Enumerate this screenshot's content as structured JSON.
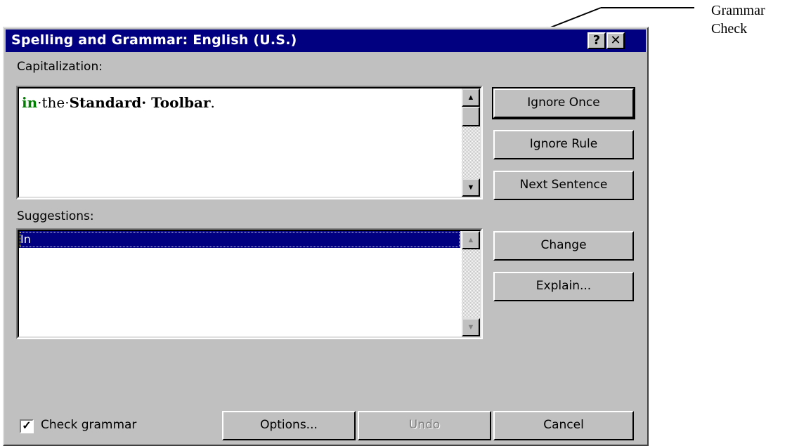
{
  "annotation": {
    "line1": "Grammar",
    "line2": "Check"
  },
  "dialog": {
    "title": "Spelling and Grammar: English (U.S.)",
    "help_glyph": "?",
    "close_glyph": "✕"
  },
  "issue": {
    "label": "Capitalization:",
    "sentence": {
      "error_word": "in",
      "middle": "·the·",
      "bold_words": "Standard· Toolbar",
      "end": "."
    }
  },
  "suggestions": {
    "label": "Suggestions:",
    "items": [
      "In"
    ]
  },
  "buttons": {
    "ignore_once": "Ignore Once",
    "ignore_rule": "Ignore Rule",
    "next_sentence": "Next Sentence",
    "change": "Change",
    "explain": "Explain...",
    "options": "Options...",
    "undo": "Undo",
    "cancel": "Cancel"
  },
  "check_grammar": {
    "label": "Check grammar",
    "checked": true
  }
}
